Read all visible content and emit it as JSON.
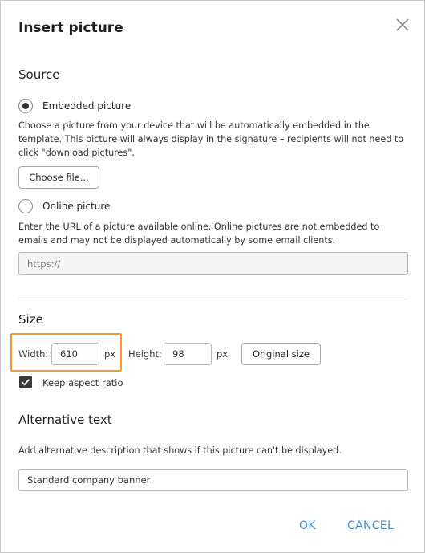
{
  "dialog": {
    "title": "Insert picture"
  },
  "source": {
    "heading": "Source",
    "embedded": {
      "label": "Embedded picture",
      "checked": true,
      "description": "Choose a picture from your device that will be automatically embedded in the template. This picture will always display in the signature – recipients will not need to click \"download pictures\".",
      "button_label": "Choose file..."
    },
    "online": {
      "label": "Online picture",
      "checked": false,
      "description": "Enter the URL of a picture available online. Online pictures are not embedded to emails and may not be displayed automatically by some email clients.",
      "url_placeholder": "https://"
    }
  },
  "size": {
    "heading": "Size",
    "width_label": "Width:",
    "width_value": "610",
    "width_unit": "px",
    "height_label": "Height:",
    "height_value": "98",
    "height_unit": "px",
    "original_size_label": "Original size",
    "keep_aspect_label": "Keep aspect ratio",
    "keep_aspect_checked": true
  },
  "alt_text": {
    "heading": "Alternative text",
    "description": "Add alternative description that shows if this picture can't be displayed.",
    "value": "Standard company banner"
  },
  "footer": {
    "ok_label": "OK",
    "cancel_label": "CANCEL"
  },
  "colors": {
    "accent": "#4a8ed1",
    "highlight": "#f39c2e"
  },
  "icons": {
    "close": "close-icon",
    "check": "checkmark-icon"
  }
}
